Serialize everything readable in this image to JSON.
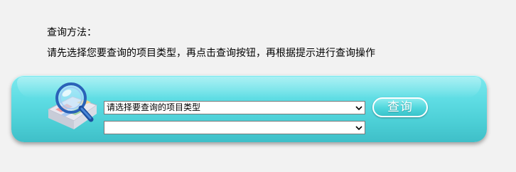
{
  "instructions": {
    "title": "查询方法：",
    "description": "请先选择您要查询的项目类型，再点击查询按钮，再根据提示进行查询操作"
  },
  "search_panel": {
    "type_select": {
      "selected": "请选择要查询的项目类型"
    },
    "item_select": {
      "selected": ""
    },
    "query_button_label": "查询",
    "icon": "magnifier-over-map-icon"
  },
  "colors": {
    "background": "#f2f2f2",
    "panel_top": "#7fe9ee",
    "panel_bottom": "#3fbfc8",
    "button_border": "#ffffff"
  }
}
